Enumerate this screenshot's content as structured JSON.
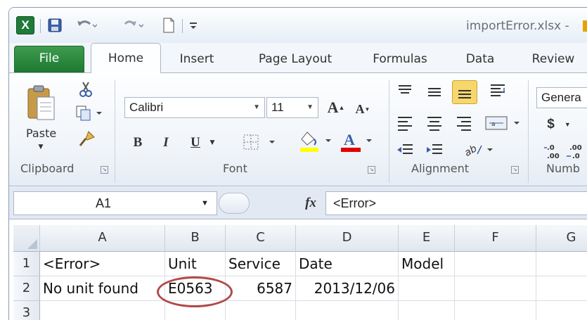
{
  "window": {
    "title": "importError.xlsx - "
  },
  "quick_access": {
    "logo": "X"
  },
  "tabs": [
    {
      "label": "File"
    },
    {
      "label": "Home"
    },
    {
      "label": "Insert"
    },
    {
      "label": "Page Layout"
    },
    {
      "label": "Formulas"
    },
    {
      "label": "Data"
    },
    {
      "label": "Review"
    }
  ],
  "ribbon": {
    "clipboard": {
      "label": "Clipboard",
      "paste_label": "Paste"
    },
    "font": {
      "label": "Font",
      "font_name": "Calibri",
      "font_size": "11",
      "bold": "B",
      "italic": "I",
      "underline": "U"
    },
    "alignment": {
      "label": "Alignment"
    },
    "number": {
      "label": "Numb",
      "format": "Genera",
      "currency": "$"
    }
  },
  "formula_bar": {
    "name_box": "A1",
    "fx": "fx",
    "content": "<Error>"
  },
  "sheet": {
    "columns": [
      "A",
      "B",
      "C",
      "D",
      "E",
      "F",
      "G"
    ],
    "rows": [
      "1",
      "2",
      "3"
    ],
    "cells": {
      "A1": "<Error>",
      "B1": "Unit",
      "C1": "Service",
      "D1": "Date",
      "E1": "Model",
      "A2": "No unit found",
      "B2": "E0563",
      "C2": "6587",
      "D2": "2013/12/06"
    }
  },
  "colors": {
    "file_tab": "#1e7a31",
    "highlight_circle": "#b14a48",
    "active_align": "#f7d76b"
  }
}
